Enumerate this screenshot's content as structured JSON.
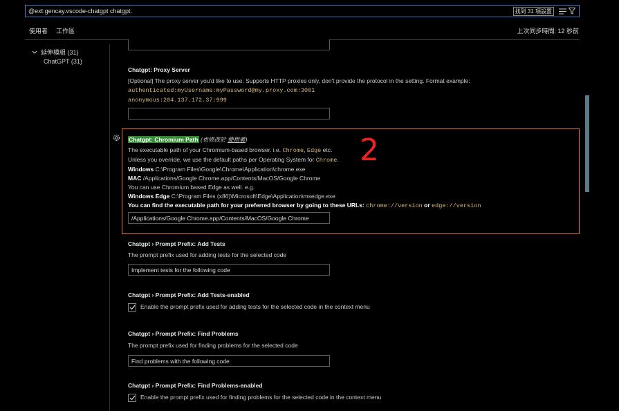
{
  "search": {
    "value": "@ext:gencay.vscode-chatgpt chatgpt.",
    "result_count": "找到 31 項設置"
  },
  "tabs": [
    "使用者",
    "工作區"
  ],
  "sync_status": "上次同步時間: 12 秒前",
  "toc": {
    "group": "延伸模組 (31)",
    "item": "ChatGPT (31)"
  },
  "proxy": {
    "title": "Chatgpt: Proxy Server",
    "desc": "[Optional] The proxy server you'd like to use. Supports HTTP proxies only, don't provide the protocol in the setting. Format example:",
    "example1": "authenticated:myUsername:myPassword@my.proxy.com:3001",
    "example2": "anonymous:204.137.172.37:999",
    "value": ""
  },
  "chromium": {
    "title": "Chatgpt: Chromium Path",
    "modified_prefix": "(也修改於",
    "modified_link": "使用者",
    "modified_suffix": ")",
    "line1_a": "The executable path of your Chromium-based browser. i.e.",
    "line1_code1": "Chrome",
    "line1_comma": ",",
    "line1_code2": "Edge",
    "line1_b": "etc.",
    "line2_a": "Unless you override, we use the default paths per Operating System for",
    "line2_code": "Chrome",
    "line2_b": ".",
    "win_label": "Windows",
    "win_path": "C:\\Program Files\\Google\\Chrome\\Application\\chrome.exe",
    "mac_label": "MAC",
    "mac_path": "/Applications/Google Chrome.app/Contents/MacOS/Google Chrome",
    "edge_note": "You can use Chromium based Edge as well. e.g.",
    "winedge_label": "Windows Edge",
    "winedge_path": "C:\\Program Files (x86)\\Microsoft\\Edge\\Application\\msedge.exe",
    "find_text": "You can find the executable path for your preferred browser by going to these URLs:",
    "url1": "chrome://version",
    "or": "or",
    "url2": "edge://version",
    "value": "/Applications/Google Chrome.app/Contents/MacOS/Google Chrome"
  },
  "annotation": "2",
  "add_tests": {
    "title": "Chatgpt › Prompt Prefix: Add Tests",
    "desc": "The prompt prefix used for adding tests for the selected code",
    "value": "Implement tests for the following code"
  },
  "add_tests_enabled": {
    "title": "Chatgpt › Prompt Prefix: Add Tests-enabled",
    "label": "Enable the prompt prefix used for adding tests for the selected code in the context menu",
    "checked": true
  },
  "find_problems": {
    "title": "Chatgpt › Prompt Prefix: Find Problems",
    "desc": "The prompt prefix used for finding problems for the selected code",
    "value": "Find problems with the following code"
  },
  "find_problems_enabled": {
    "title": "Chatgpt › Prompt Prefix: Find Problems-enabled",
    "label": "Enable the prompt prefix used for finding problems for the selected code in the context menu",
    "checked": true
  },
  "colors": {
    "accent": "#3b7fc4",
    "highlight": "#2e8b2e",
    "focus_border": "#e07b3b",
    "annotation": "#ee2222",
    "code": "#d7ba7d"
  }
}
